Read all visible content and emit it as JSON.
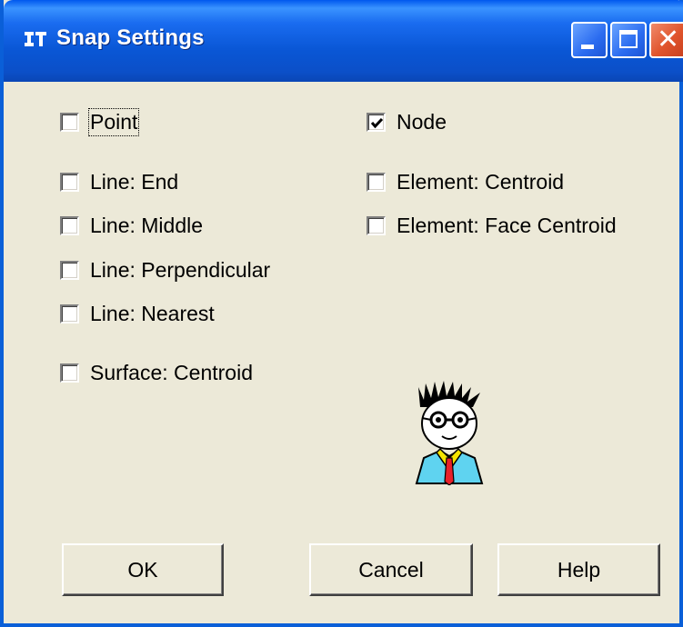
{
  "window": {
    "title": "Snap Settings"
  },
  "titlebar_buttons": {
    "minimize": "minimize-icon",
    "maximize": "maximize-icon",
    "close": "close-icon"
  },
  "options_left": [
    {
      "label": "Point",
      "checked": false
    },
    {
      "label": "Line: End",
      "checked": false
    },
    {
      "label": "Line: Middle",
      "checked": false
    },
    {
      "label": "Line: Perpendicular",
      "checked": false
    },
    {
      "label": "Line: Nearest",
      "checked": false
    },
    {
      "label": "Surface: Centroid",
      "checked": false
    }
  ],
  "options_right": [
    {
      "label": "Node",
      "checked": true
    },
    {
      "label": "Element: Centroid",
      "checked": false
    },
    {
      "label": "Element: Face Centroid",
      "checked": false
    }
  ],
  "buttons": {
    "ok": "OK",
    "cancel": "Cancel",
    "help": "Help"
  },
  "colors": {
    "titlebar": "#0a57d6",
    "dialog_bg": "#ece9d8",
    "close_button": "#e0542c"
  }
}
